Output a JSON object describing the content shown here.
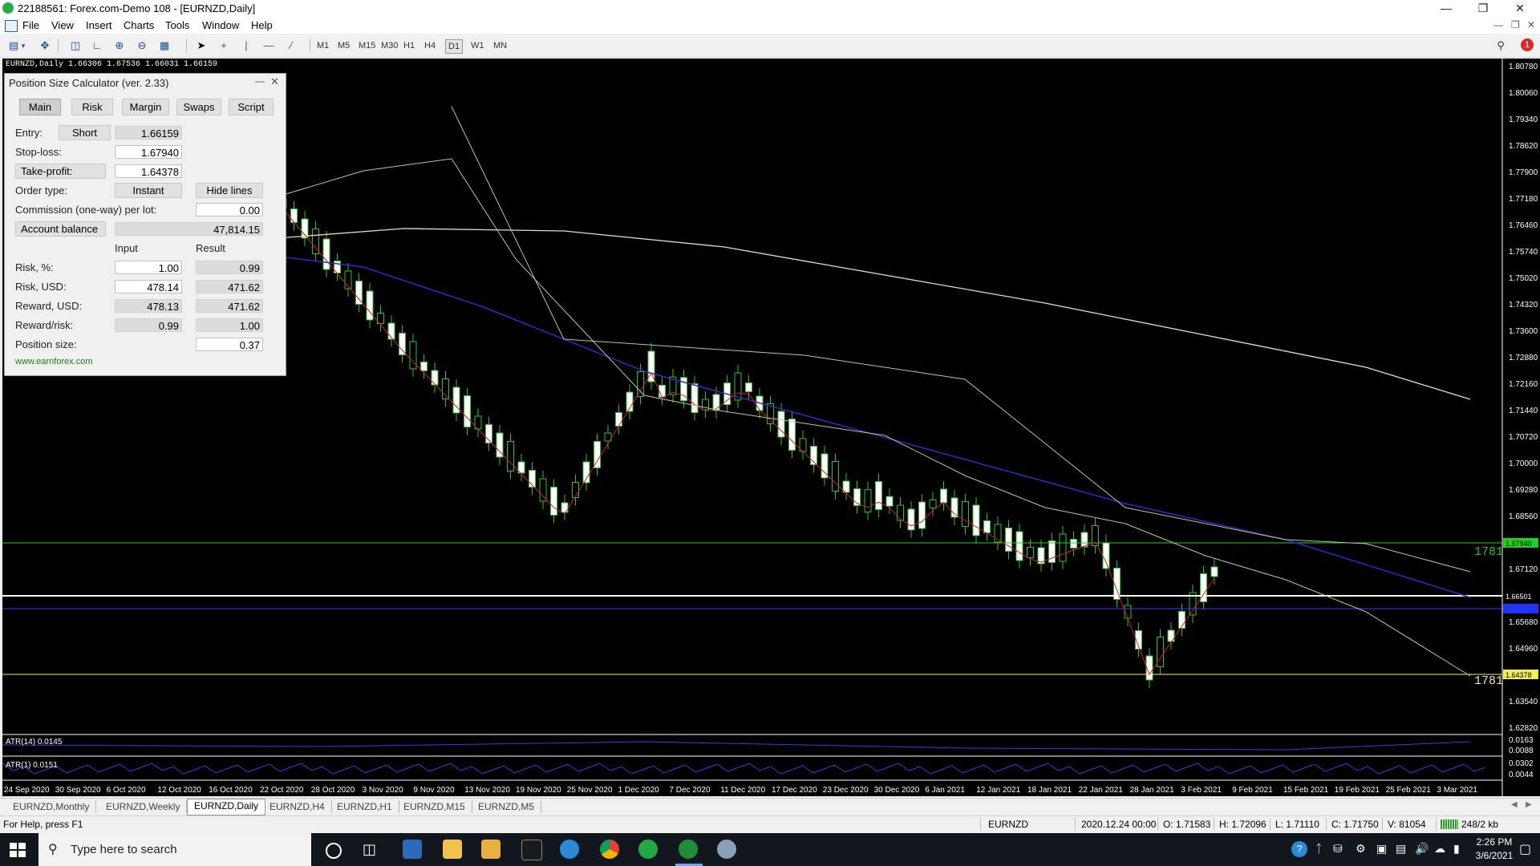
{
  "window": {
    "title": "22188561: Forex.com-Demo 108 - [EURNZD,Daily]"
  },
  "menu": [
    "File",
    "View",
    "Insert",
    "Charts",
    "Tools",
    "Window",
    "Help"
  ],
  "timeframes": [
    "M1",
    "M5",
    "M15",
    "M30",
    "H1",
    "H4",
    "D1",
    "W1",
    "MN"
  ],
  "active_timeframe": "D1",
  "chart": {
    "info_line": "EURNZD,Daily  1.66306 1.67536 1.66031 1.66159",
    "price_labels": [
      "1.80780",
      "1.80060",
      "1.79340",
      "1.78620",
      "1.77900",
      "1.77180",
      "1.76460",
      "1.75740",
      "1.75020",
      "1.74320",
      "1.73600",
      "1.72880",
      "1.72160",
      "1.71440",
      "1.70720",
      "1.70000",
      "1.69280",
      "1.68560",
      "1.67940",
      "1.67120",
      "1.66501",
      "1.65680",
      "1.64960",
      "1.64378",
      "1.63540",
      "1.62820"
    ],
    "highlight_labels": {
      "stop_loss": "1.67940",
      "bid": "1.66501",
      "take_profit": "1.64378"
    },
    "line_label_sl": "1781",
    "line_label_tp": "1781",
    "date_labels": [
      "24 Sep 2020",
      "30 Sep 2020",
      "6 Oct 2020",
      "12 Oct 2020",
      "16 Oct 2020",
      "22 Oct 2020",
      "28 Oct 2020",
      "3 Nov 2020",
      "9 Nov 2020",
      "13 Nov 2020",
      "19 Nov 2020",
      "25 Nov 2020",
      "1 Dec 2020",
      "7 Dec 2020",
      "11 Dec 2020",
      "17 Dec 2020",
      "23 Dec 2020",
      "30 Dec 2020",
      "6 Jan 2021",
      "12 Jan 2021",
      "18 Jan 2021",
      "22 Jan 2021",
      "28 Jan 2021",
      "3 Feb 2021",
      "9 Feb 2021",
      "15 Feb 2021",
      "19 Feb 2021",
      "25 Feb 2021",
      "3 Mar 2021"
    ],
    "atr14_label": "ATR(14) 0.0145",
    "atr14_scale": [
      "0.0163",
      "0.0088"
    ],
    "atr1_label": "ATR(1) 0.0151",
    "atr1_scale": [
      "0.0302",
      "0.0044"
    ]
  },
  "calculator": {
    "title": "Position Size Calculator (ver. 2.33)",
    "tabs": [
      "Main",
      "Risk",
      "Margin",
      "Swaps",
      "Script"
    ],
    "entry_label": "Entry:",
    "entry_type": "Short",
    "entry_value": "1.66159",
    "stoploss_label": "Stop-loss:",
    "stoploss_value": "1.67940",
    "takeprofit_label": "Take-profit:",
    "takeprofit_value": "1.64378",
    "ordertype_label": "Order type:",
    "ordertype_value": "Instant",
    "hidelines_label": "Hide lines",
    "commission_label": "Commission (one-way) per lot:",
    "commission_value": "0.00",
    "balance_label": "Account balance",
    "balance_value": "47,814.15",
    "col_input": "Input",
    "col_result": "Result",
    "risk_pct_label": "Risk, %:",
    "risk_pct_input": "1.00",
    "risk_pct_result": "0.99",
    "risk_usd_label": "Risk, USD:",
    "risk_usd_input": "478.14",
    "risk_usd_result": "471.62",
    "reward_usd_label": "Reward, USD:",
    "reward_usd_input": "478.13",
    "reward_usd_result": "471.62",
    "reward_risk_label": "Reward/risk:",
    "reward_risk_input": "0.99",
    "reward_risk_result": "1.00",
    "position_size_label": "Position size:",
    "position_size_value": "0.37",
    "link": "www.earnforex.com"
  },
  "chart_tabs": [
    "EURNZD,Monthly",
    "EURNZD,Weekly",
    "EURNZD,Daily",
    "EURNZD,H4",
    "EURNZD,H1",
    "EURNZD,M15",
    "EURNZD,M5"
  ],
  "active_chart_tab": "EURNZD,Daily",
  "status": {
    "help": "For Help, press F1",
    "symbol": "EURNZD",
    "datetime": "2020.12.24 00:00",
    "open": "O: 1.71583",
    "high": "H: 1.72096",
    "low": "L: 1.71110",
    "close": "C: 1.71750",
    "volume": "V: 81054",
    "traffic": "248/2 kb"
  },
  "taskbar": {
    "search_placeholder": "Type here to search",
    "time": "2:26 PM",
    "date": "3/6/2021"
  }
}
